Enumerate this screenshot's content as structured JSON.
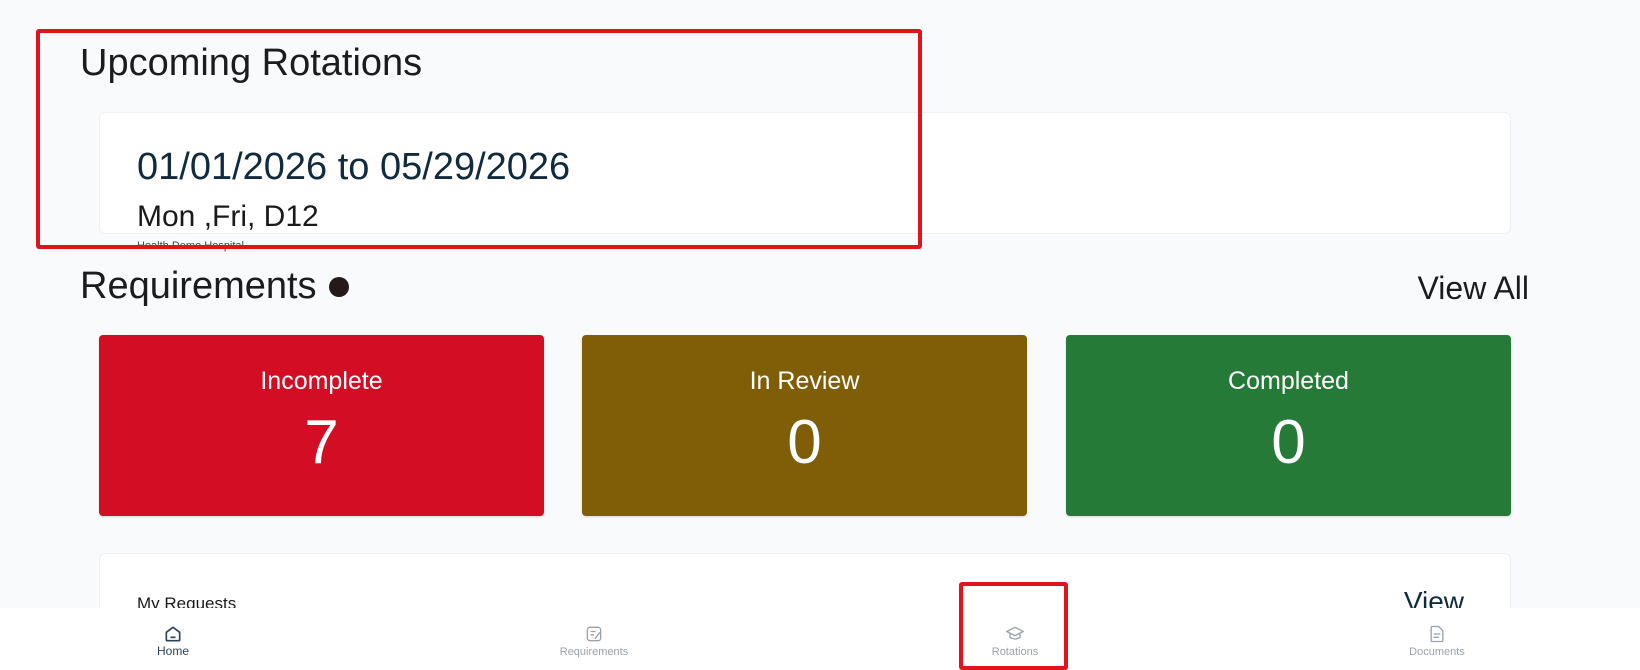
{
  "upcoming": {
    "title": "Upcoming Rotations",
    "dates": "01/01/2026 to 05/29/2026",
    "days": "Mon ,Fri, D12",
    "site": "Health Demo Hospital"
  },
  "requirements": {
    "title": "Requirements",
    "view_all": "View All",
    "cards": [
      {
        "label": "Incomplete",
        "count": "7",
        "color": "#d20d24"
      },
      {
        "label": "In Review",
        "count": "0",
        "color": "#7f5e07"
      },
      {
        "label": "Completed",
        "count": "0",
        "color": "#257a37"
      }
    ]
  },
  "requests": {
    "label": "My Requests",
    "view": "View"
  },
  "nav": {
    "items": [
      {
        "label": "Home",
        "icon": "home-icon",
        "active": true
      },
      {
        "label": "Requirements",
        "icon": "checklist-icon",
        "active": false
      },
      {
        "label": "Rotations",
        "icon": "graduation-cap-icon",
        "active": false
      },
      {
        "label": "Documents",
        "icon": "document-icon",
        "active": false
      }
    ]
  },
  "annotations": {
    "highlight_color": "#e3131b"
  }
}
